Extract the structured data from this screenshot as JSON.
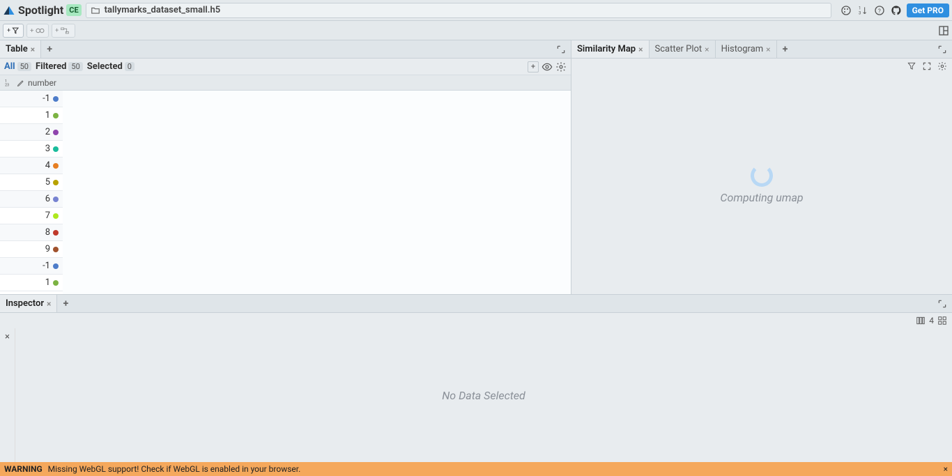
{
  "header": {
    "app_name": "Spotlight",
    "edition_badge": "CE",
    "filename": "tallymarks_dataset_small.h5",
    "get_pro": "Get PRO"
  },
  "tabs_left": {
    "tabs": [
      {
        "label": "Table",
        "active": true
      }
    ]
  },
  "tabs_right": {
    "tabs": [
      {
        "label": "Similarity Map",
        "active": true
      },
      {
        "label": "Scatter Plot",
        "active": false
      },
      {
        "label": "Histogram",
        "active": false
      }
    ]
  },
  "filters": {
    "all_label": "All",
    "all_count": "50",
    "filtered_label": "Filtered",
    "filtered_count": "50",
    "selected_label": "Selected",
    "selected_count": "0"
  },
  "column_header": {
    "name": "number"
  },
  "rows": [
    {
      "value": "-1",
      "color": "#4d7cc9"
    },
    {
      "value": "1",
      "color": "#7cb342"
    },
    {
      "value": "2",
      "color": "#8e44ad"
    },
    {
      "value": "3",
      "color": "#1abc9c"
    },
    {
      "value": "4",
      "color": "#e67e22"
    },
    {
      "value": "5",
      "color": "#b8a200"
    },
    {
      "value": "6",
      "color": "#7783d1"
    },
    {
      "value": "7",
      "color": "#aee81e"
    },
    {
      "value": "8",
      "color": "#c0392b"
    },
    {
      "value": "9",
      "color": "#a0522d"
    },
    {
      "value": "-1",
      "color": "#4d7cc9"
    },
    {
      "value": "1",
      "color": "#7cb342"
    }
  ],
  "map_panel": {
    "loading_text": "Computing umap"
  },
  "inspector": {
    "tab_label": "Inspector",
    "count": "4",
    "empty_text": "No Data Selected"
  },
  "warning": {
    "label": "WARNING",
    "message": "Missing WebGL support! Check if WebGL is enabled in your browser."
  }
}
